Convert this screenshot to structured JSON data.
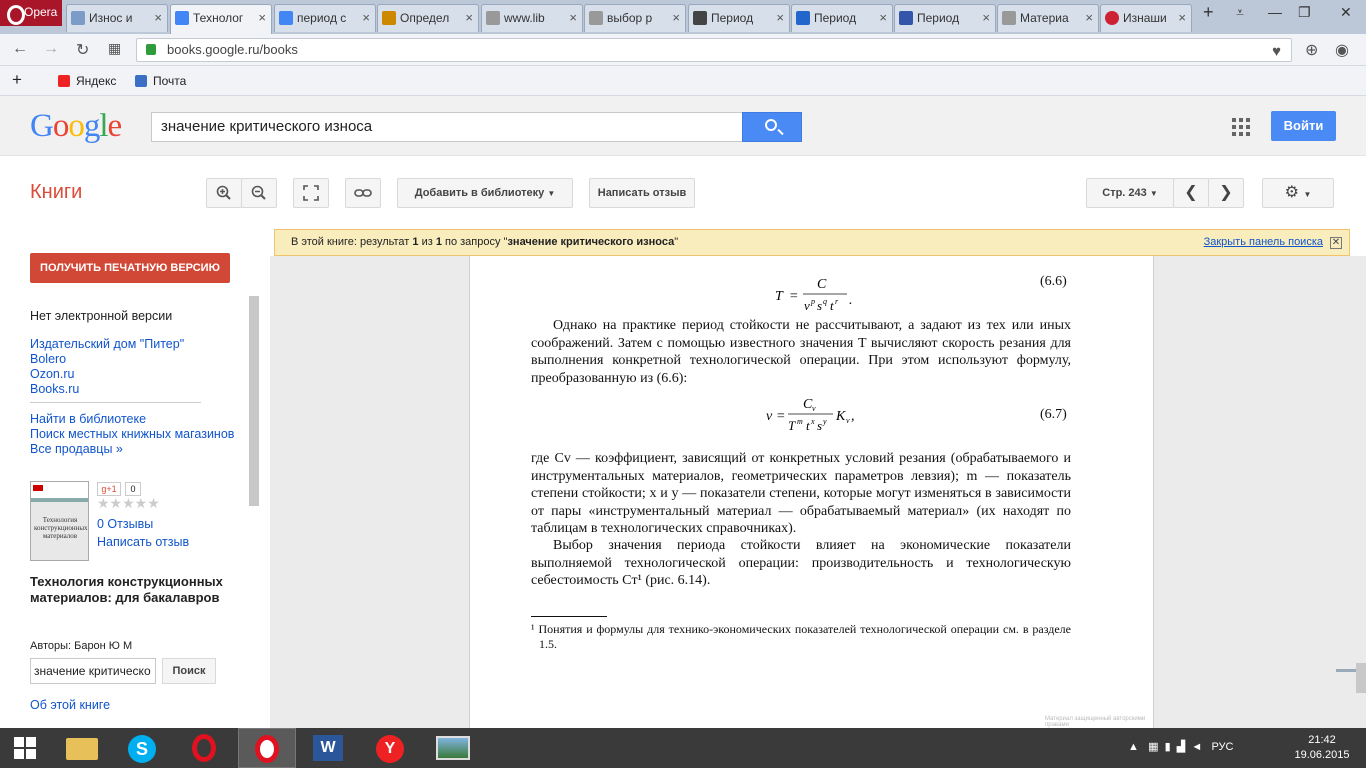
{
  "browser": {
    "menu_label": "Opera",
    "tabs": [
      {
        "label": "Износ и",
        "color": "#7a9cc6"
      },
      {
        "label": "Технолог",
        "color": "#4285f4",
        "active": true
      },
      {
        "label": "период с",
        "color": "#4285f4"
      },
      {
        "label": "Определ",
        "color": "#cc8800"
      },
      {
        "label": "www.lib",
        "color": "#999999"
      },
      {
        "label": "выбор р",
        "color": "#999999"
      },
      {
        "label": "Период",
        "color": "#444444"
      },
      {
        "label": "Период",
        "color": "#2266cc"
      },
      {
        "label": "Период",
        "color": "#3355aa"
      },
      {
        "label": "Материа",
        "color": "#999999"
      },
      {
        "label": "Изнаши",
        "color": "#cc2233"
      }
    ],
    "url": "books.google.ru/books",
    "bookmarks": [
      {
        "label": "Яндекс",
        "color": "#e22"
      },
      {
        "label": "Почта",
        "color": "#3a6fc4"
      }
    ]
  },
  "google": {
    "logo_letters": [
      "G",
      "o",
      "o",
      "g",
      "l",
      "e"
    ],
    "search_value": "значение критического износа",
    "signin_label": "Войти"
  },
  "toolbar": {
    "section_title": "Книги",
    "add_library": "Добавить в библиотеку",
    "write_review": "Написать отзыв",
    "page_label": "Стр. 243"
  },
  "banner": {
    "prefix": "В этой книге: результат ",
    "num1": "1",
    "middle": " из ",
    "num2": "1",
    "suffix": " по запросу \"",
    "query": "значение критического износа",
    "close_quote": "\"",
    "link": "Закрыть панель поиска"
  },
  "sidebar": {
    "print_button": "ПОЛУЧИТЬ ПЕЧАТНУЮ ВЕРСИЮ",
    "no_ebook": "Нет электронной версии",
    "sellers": [
      "Издательский дом \"Питер\"",
      "Bolero",
      "Ozon.ru",
      "Books.ru"
    ],
    "library_links": [
      "Найти в библиотеке",
      "Поиск местных книжных магазинов",
      "Все продавцы »"
    ],
    "gplus": "g+1",
    "gplus_count": "0",
    "reviews": "0 Отзывы",
    "write_review": "Написать отзыв",
    "book_title": "Технология конструкционных материалов: для бакалавров",
    "authors": "Авторы: Барон Ю М",
    "search_value": "значение критическо",
    "search_button": "Поиск",
    "about": "Об этой книге",
    "cover_text": "Технология конструкционных материалов"
  },
  "page": {
    "eq66_num": "(6.6)",
    "eq67_num": "(6.7)",
    "para1": "Однако на практике период стойкости не рассчитывают, а задают из тех или иных соображений. Затем с помощью известного значения T вычисляют скорость резания для выполнения конкретной технологической операции. При этом используют формулу, преобразованную из (6.6):",
    "para2": "где Cv — коэффициент, зависящий от конкретных условий резания (обрабатываемого и инструментальных материалов, геометрических параметров левзия); m — показатель степени стойкости; x и y — показатели степени, которые могут изменяться в зависимости от пары «инструментальный материал — обрабатываемый материал» (их находят по таблицам в технологических справочниках).",
    "para3": "Выбор значения периода стойкости влияет на экономические показатели выполняемой технологической операции: производительность и технологическую себестоимость Cт¹ (рис. 6.14).",
    "footnote": "¹ Понятия и формулы для технико-экономических показателей технологической операции см. в разделе 1.5.",
    "watermark": "Материал защищенный авторскими правами"
  },
  "taskbar": {
    "lang": "РУС",
    "time": "21:42",
    "date": "19.06.2015"
  }
}
